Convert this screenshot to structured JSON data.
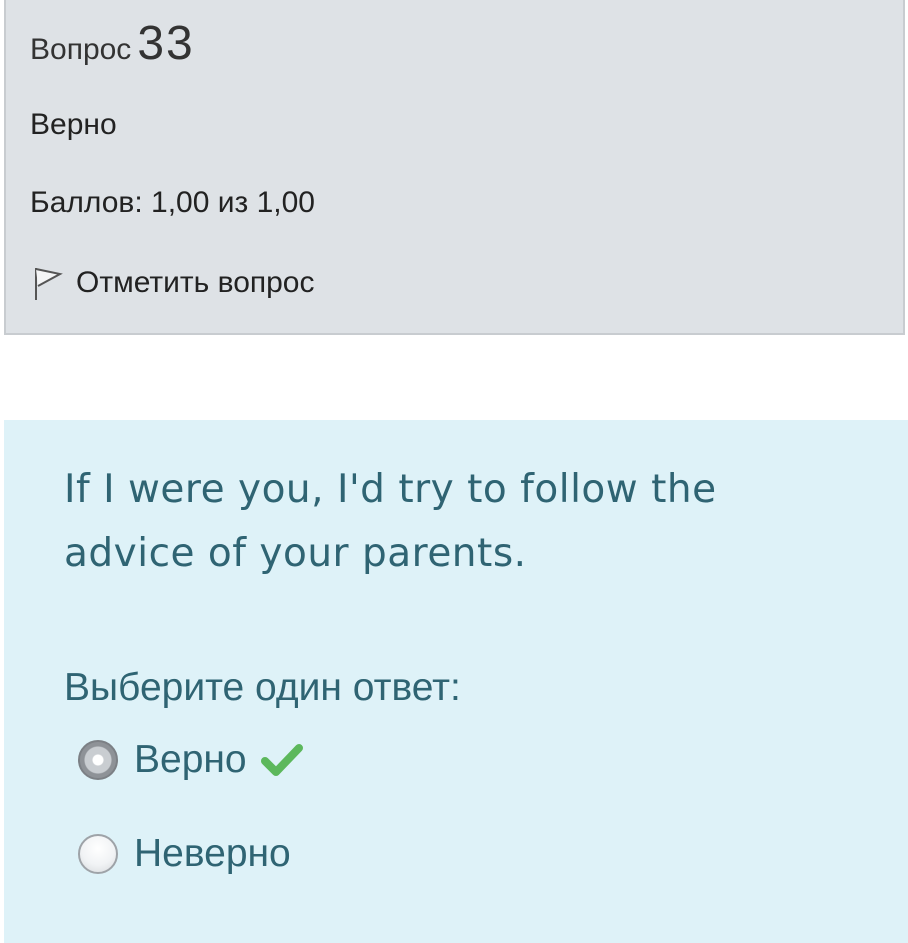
{
  "info": {
    "question_word": "Вопрос",
    "question_number": "33",
    "status": "Верно",
    "grade": "Баллов: 1,00 из 1,00",
    "flag_label": "Отметить вопрос",
    "flag_icon": "flag-outline-icon"
  },
  "question": {
    "text": "If I were you, I'd try to follow the advice of your parents.",
    "prompt": "Выберите один ответ:",
    "options": [
      {
        "label": "Верно",
        "selected": true,
        "correct": true
      },
      {
        "label": "Неверно",
        "selected": false,
        "correct": false
      }
    ],
    "correct_icon": "checkmark-icon"
  },
  "colors": {
    "info_bg": "#dee2e6",
    "question_bg": "#def2f8",
    "question_text": "#2f6473",
    "correct": "#5cb85c"
  }
}
